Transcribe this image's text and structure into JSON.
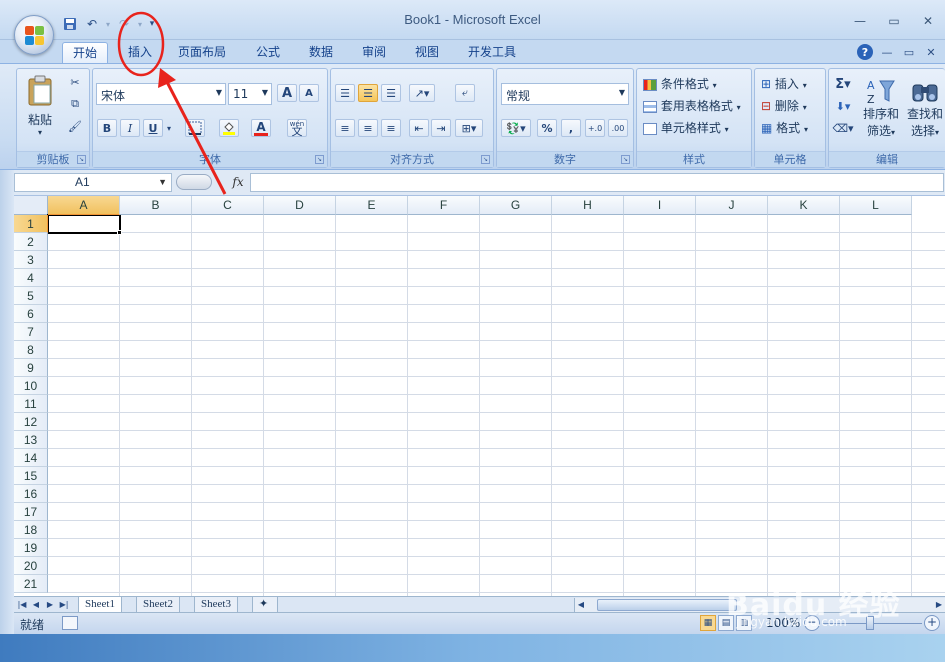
{
  "window": {
    "title": "Book1 - Microsoft Excel",
    "controls": [
      "—",
      "▭",
      "✕"
    ]
  },
  "qat": {
    "save_icon": "save-icon",
    "undo_icon": "undo-icon",
    "redo_icon": "redo-icon",
    "customize_icon": "dropdown-icon"
  },
  "tabs": [
    {
      "label": "开始",
      "active": true
    },
    {
      "label": "插入",
      "active": false
    },
    {
      "label": "页面布局",
      "active": false
    },
    {
      "label": "公式",
      "active": false
    },
    {
      "label": "数据",
      "active": false
    },
    {
      "label": "审阅",
      "active": false
    },
    {
      "label": "视图",
      "active": false
    },
    {
      "label": "开发工具",
      "active": false
    }
  ],
  "ribbon": {
    "clipboard": {
      "label": "剪贴板",
      "paste": "粘贴"
    },
    "font": {
      "label": "字体",
      "name": "宋体",
      "size": "11",
      "bold": "B",
      "italic": "I",
      "underline": "U",
      "grow": "A",
      "shrink": "A",
      "color": "A",
      "phonetic": "文"
    },
    "alignment": {
      "label": "对齐方式"
    },
    "number": {
      "label": "数字",
      "format": "常规",
      "percent": "%",
      "comma": ","
    },
    "styles": {
      "label": "样式",
      "conditional": "条件格式",
      "table": "套用表格格式",
      "cell": "单元格样式"
    },
    "cells": {
      "label": "单元格",
      "insert": "插入",
      "delete": "删除",
      "format": "格式"
    },
    "editing": {
      "label": "编辑",
      "sort_line1": "排序和",
      "sort_line2": "筛选",
      "find_line1": "查找和",
      "find_line2": "选择"
    }
  },
  "formula_bar": {
    "name_box": "A1",
    "fx": "fx",
    "value": ""
  },
  "grid": {
    "columns": [
      "A",
      "B",
      "C",
      "D",
      "E",
      "F",
      "G",
      "H",
      "I",
      "J",
      "K",
      "L"
    ],
    "rows": [
      "1",
      "2",
      "3",
      "4",
      "5",
      "6",
      "7",
      "8",
      "9",
      "10",
      "11",
      "12",
      "13",
      "14",
      "15",
      "16",
      "17",
      "18",
      "19",
      "20",
      "21"
    ],
    "active_cell": "A1"
  },
  "sheets": [
    {
      "label": "Sheet1",
      "active": true
    },
    {
      "label": "Sheet2",
      "active": false
    },
    {
      "label": "Sheet3",
      "active": false
    }
  ],
  "status": {
    "ready": "就绪",
    "zoom": "100%"
  },
  "watermark": {
    "brand": "Baidu 经验",
    "url": "jingyan.baidu.com"
  },
  "annotation_color": "#e8231c"
}
